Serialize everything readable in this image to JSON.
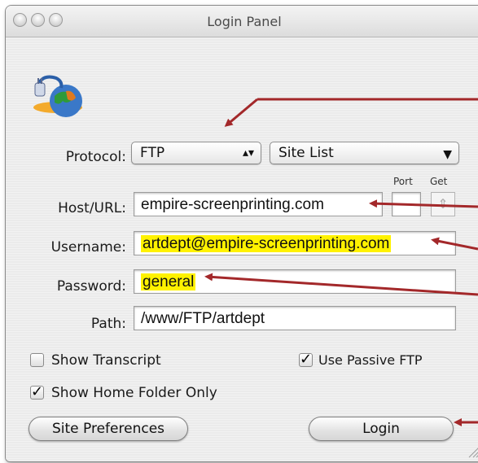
{
  "window": {
    "title": "Login Panel"
  },
  "protocol": {
    "label": "Protocol:",
    "value": "FTP",
    "site_list": "Site List"
  },
  "port_label": "Port",
  "get_label": "Get",
  "host": {
    "label": "Host/URL:",
    "value": "empire-screenprinting.com"
  },
  "username": {
    "label": "Username:",
    "value": "artdept@empire-screenprinting.com"
  },
  "password": {
    "label": "Password:",
    "value": "general"
  },
  "path": {
    "label": "Path:",
    "value": "/www/FTP/artdept"
  },
  "options": {
    "show_transcript": {
      "label": "Show Transcript",
      "checked": false
    },
    "use_passive_ftp": {
      "label": "Use Passive FTP",
      "checked": true
    },
    "show_home_folder_only": {
      "label": "Show Home Folder Only",
      "checked": true
    }
  },
  "buttons": {
    "site_preferences": "Site Preferences",
    "login": "Login"
  },
  "colors": {
    "highlight": "#fff200",
    "annotation_arrow": "#a3282a"
  },
  "icons": {
    "app_logo": "globe-plug-icon"
  }
}
